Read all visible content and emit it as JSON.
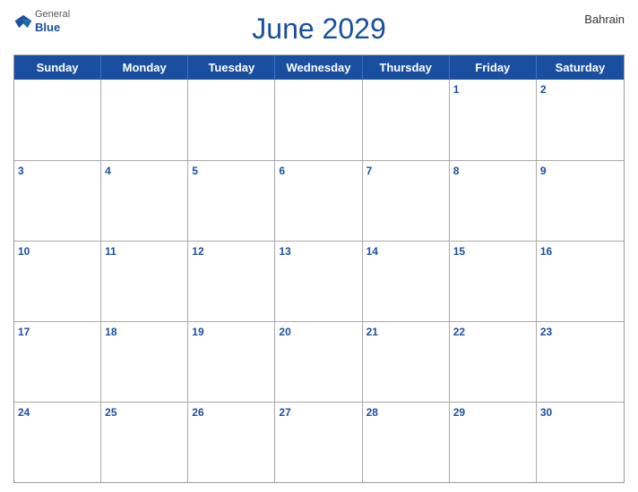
{
  "header": {
    "logo": {
      "line1": "General",
      "line2": "Blue"
    },
    "title": "June 2029",
    "country": "Bahrain"
  },
  "days_of_week": [
    "Sunday",
    "Monday",
    "Tuesday",
    "Wednesday",
    "Thursday",
    "Friday",
    "Saturday"
  ],
  "weeks": [
    [
      null,
      null,
      null,
      null,
      null,
      1,
      2
    ],
    [
      3,
      4,
      5,
      6,
      7,
      8,
      9
    ],
    [
      10,
      11,
      12,
      13,
      14,
      15,
      16
    ],
    [
      17,
      18,
      19,
      20,
      21,
      22,
      23
    ],
    [
      24,
      25,
      26,
      27,
      28,
      29,
      30
    ]
  ],
  "colors": {
    "primary": "#1a4fa0",
    "header_bg": "#1a4fa0",
    "row_alt": "#dce8f8"
  }
}
